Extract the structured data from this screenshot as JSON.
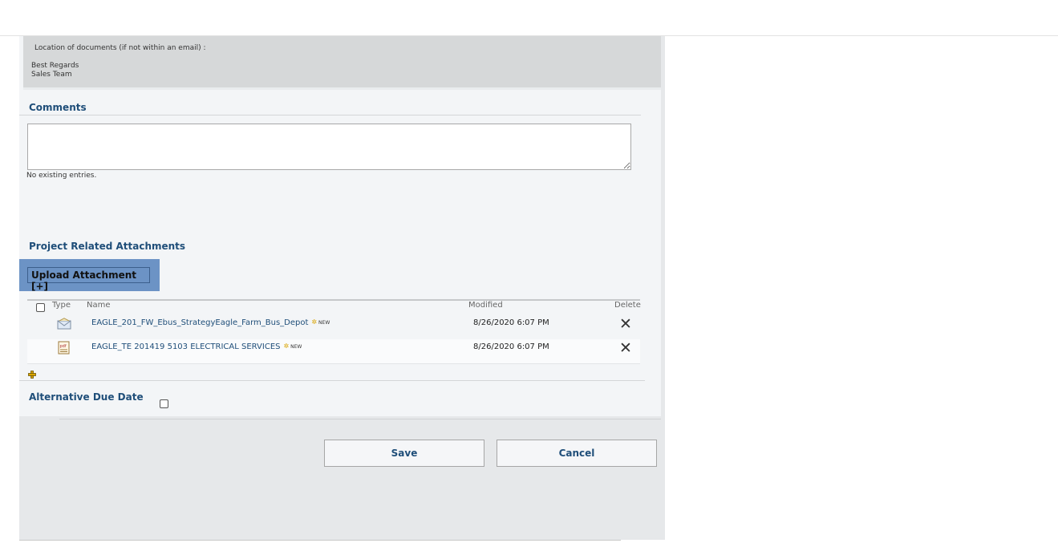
{
  "info": {
    "location_line": "Location of documents (if not within an email)   :",
    "regards_line1": "Best Regards",
    "regards_line2": "Sales Team"
  },
  "comments": {
    "title": "Comments",
    "value": "",
    "empty_text": "No existing entries."
  },
  "attachments": {
    "title": "Project Related Attachments",
    "upload_label": "Upload Attachment [+]",
    "headers": {
      "type": "Type",
      "name": "Name",
      "modified": "Modified",
      "delete": "Delete"
    },
    "rows": [
      {
        "type_icon": "email-icon",
        "name": "EAGLE_201_FW_Ebus_StrategyEagle_Farm_Bus_Depot",
        "badge": "NEW",
        "modified": "8/26/2020 6:07 PM",
        "delete_icon": "delete-icon"
      },
      {
        "type_icon": "pdf-icon",
        "name": "EAGLE_TE 201419 5103 ELECTRICAL SERVICES",
        "badge": "NEW",
        "modified": "8/26/2020 6:07 PM",
        "delete_icon": "delete-icon"
      }
    ]
  },
  "due_date": {
    "title": "Alternative Due Date"
  },
  "actions": {
    "save": "Save",
    "cancel": "Cancel"
  },
  "colors": {
    "accent": "#1f4e79",
    "upload_bg": "#6c93c5",
    "panel_bg": "#f3f5f7"
  }
}
